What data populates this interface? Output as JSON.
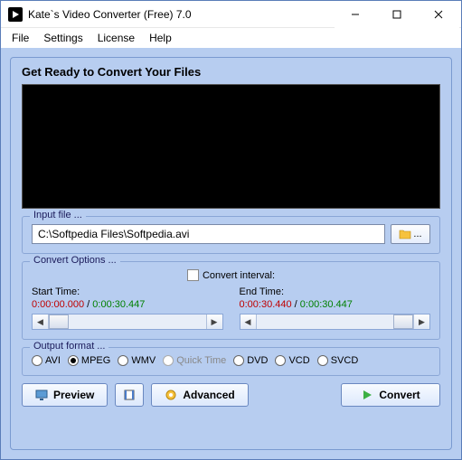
{
  "window": {
    "title": "Kate`s Video Converter (Free) 7.0"
  },
  "menu": {
    "file": "File",
    "settings": "Settings",
    "license": "License",
    "help": "Help"
  },
  "heading": "Get Ready to Convert Your Files",
  "input": {
    "group_label": "Input file ...",
    "path": "C:\\Softpedia Files\\Softpedia.avi",
    "browse_dots": "..."
  },
  "options": {
    "group_label": "Convert Options ...",
    "interval_label": "Convert interval:",
    "start_label": "Start Time:",
    "end_label": "End Time:",
    "start_current": "0:00:00.000",
    "start_total": "0:00:30.447",
    "end_current": "0:00:30.440",
    "end_total": "0:00:30.447",
    "sep": " / "
  },
  "output": {
    "group_label": "Output format ...",
    "formats": {
      "avi": "AVI",
      "mpeg": "MPEG",
      "wmv": "WMV",
      "qt": "Quick Time",
      "dvd": "DVD",
      "vcd": "VCD",
      "svcd": "SVCD"
    }
  },
  "buttons": {
    "preview": "Preview",
    "advanced": "Advanced",
    "convert": "Convert"
  }
}
